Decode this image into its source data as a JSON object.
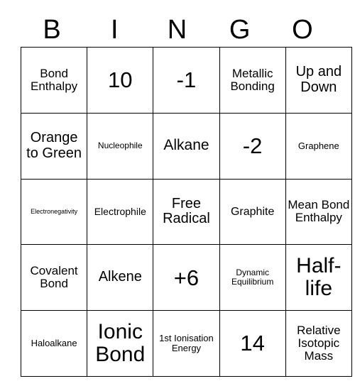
{
  "card": {
    "header_letters": [
      "B",
      "I",
      "N",
      "G",
      "O"
    ],
    "columns": 5,
    "rows": 5,
    "border_color": "#000000",
    "background_color": "#ffffff",
    "text_color": "#000000",
    "cells": [
      [
        {
          "text": "Bond Enthalpy",
          "font_size": 17
        },
        {
          "text": "10",
          "font_size": 31
        },
        {
          "text": "-1",
          "font_size": 31
        },
        {
          "text": "Metallic Bonding",
          "font_size": 17
        },
        {
          "text": "Up and Down",
          "font_size": 20
        }
      ],
      [
        {
          "text": "Orange to Green",
          "font_size": 20
        },
        {
          "text": "Nucleophile",
          "font_size": 12
        },
        {
          "text": "Alkane",
          "font_size": 21
        },
        {
          "text": "-2",
          "font_size": 31
        },
        {
          "text": "Graphene",
          "font_size": 13
        }
      ],
      [
        {
          "text": "Electronegativity",
          "font_size": 9
        },
        {
          "text": "Electrophile",
          "font_size": 14
        },
        {
          "text": "Free Radical",
          "font_size": 20
        },
        {
          "text": "Graphite",
          "font_size": 16
        },
        {
          "text": "Mean Bond Enthalpy",
          "font_size": 17
        }
      ],
      [
        {
          "text": "Covalent Bond",
          "font_size": 17
        },
        {
          "text": "Alkene",
          "font_size": 20
        },
        {
          "text": "+6",
          "font_size": 31
        },
        {
          "text": "Dynamic Equilibrium",
          "font_size": 12
        },
        {
          "text": "Half-life",
          "font_size": 30
        }
      ],
      [
        {
          "text": "Haloalkane",
          "font_size": 13
        },
        {
          "text": "Ionic Bond",
          "font_size": 30
        },
        {
          "text": "1st Ionisation Energy",
          "font_size": 13
        },
        {
          "text": "14",
          "font_size": 31
        },
        {
          "text": "Relative Isotopic Mass",
          "font_size": 17
        }
      ]
    ]
  }
}
